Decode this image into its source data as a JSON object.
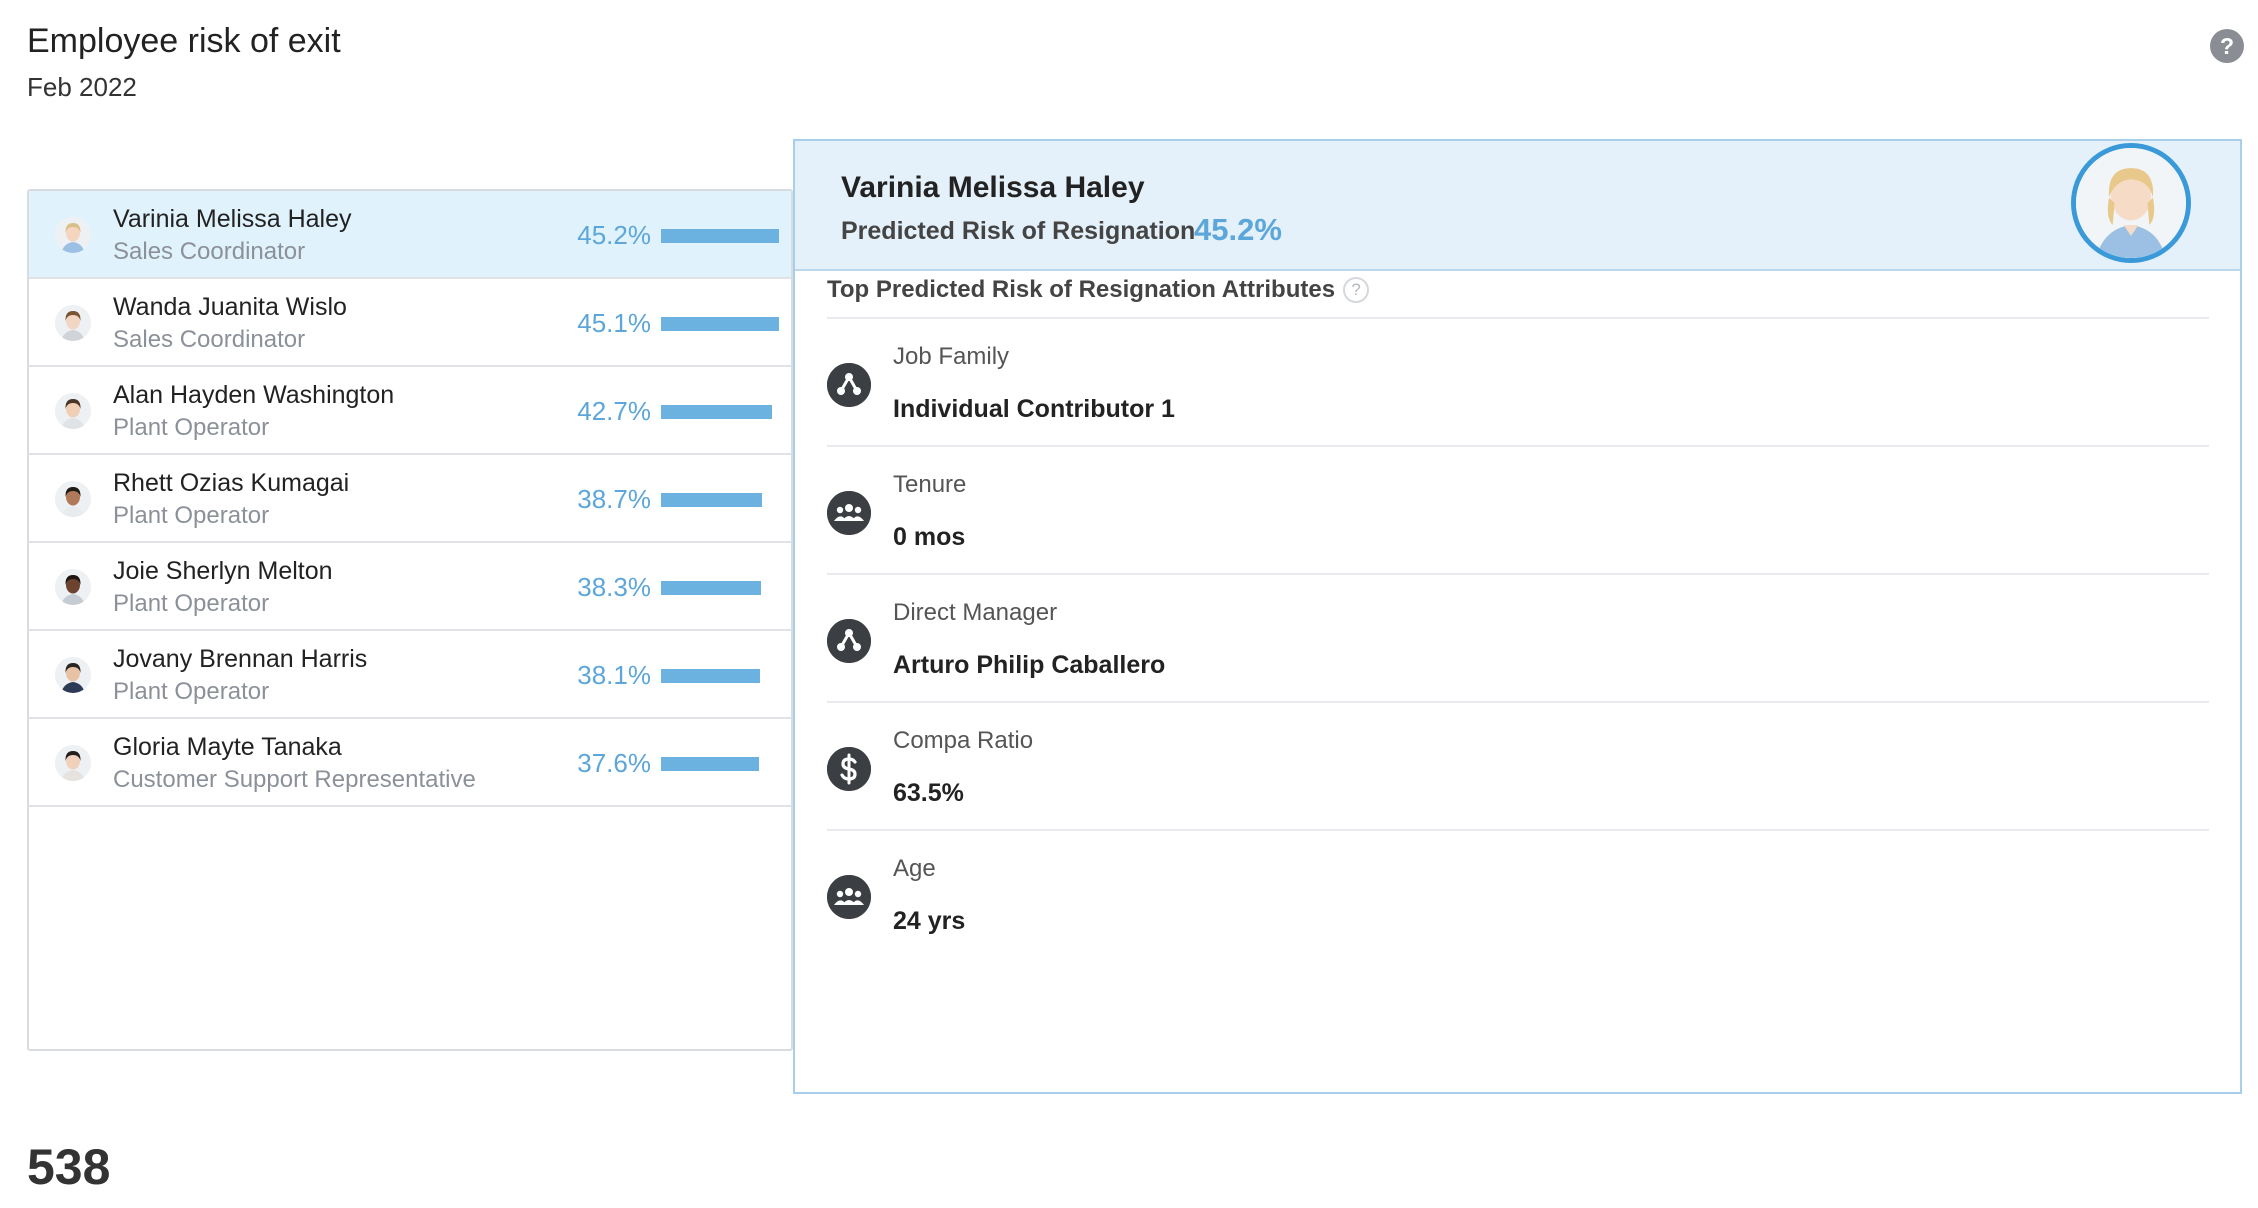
{
  "header": {
    "title": "Employee risk of exit",
    "period": "Feb 2022",
    "help_icon": "question-circle-icon",
    "help_glyph": "?"
  },
  "employees": [
    {
      "name": "Varinia Melissa Haley",
      "job": "Sales Coordinator",
      "risk": "45.2%",
      "risk_value": 45.2,
      "selected": true
    },
    {
      "name": "Wanda Juanita Wislo",
      "job": "Sales Coordinator",
      "risk": "45.1%",
      "risk_value": 45.1,
      "selected": false
    },
    {
      "name": "Alan Hayden Washington",
      "job": "Plant Operator",
      "risk": "42.7%",
      "risk_value": 42.7,
      "selected": false
    },
    {
      "name": "Rhett Ozias Kumagai",
      "job": "Plant Operator",
      "risk": "38.7%",
      "risk_value": 38.7,
      "selected": false
    },
    {
      "name": "Joie Sherlyn Melton",
      "job": "Plant Operator",
      "risk": "38.3%",
      "risk_value": 38.3,
      "selected": false
    },
    {
      "name": "Jovany Brennan Harris",
      "job": "Plant Operator",
      "risk": "38.1%",
      "risk_value": 38.1,
      "selected": false
    },
    {
      "name": "Gloria Mayte Tanaka",
      "job": "Customer Support Representative",
      "risk": "37.6%",
      "risk_value": 37.6,
      "selected": false
    }
  ],
  "detail": {
    "name": "Varinia Melissa Haley",
    "risk_label": "Predicted Risk of Resignation",
    "risk_value": "45.2%",
    "attributes_heading": "Top Predicted Risk of Resignation Attributes",
    "attributes_help_glyph": "?",
    "attributes": [
      {
        "label": "Job Family",
        "value": "Individual Contributor 1",
        "icon": "org-chart-icon"
      },
      {
        "label": "Tenure",
        "value": "0 mos",
        "icon": "group-icon"
      },
      {
        "label": "Direct Manager",
        "value": "Arturo Philip Caballero",
        "icon": "org-chart-icon"
      },
      {
        "label": "Compa Ratio",
        "value": "63.5%",
        "icon": "dollar-icon"
      },
      {
        "label": "Age",
        "value": "24 yrs",
        "icon": "group-icon"
      }
    ]
  },
  "footer": {
    "total": "538"
  },
  "colors": {
    "accent": "#5ca6d9",
    "bar": "#6bb2e1",
    "selected_row": "#e0f2fc",
    "detail_header": "#e4f1fa",
    "photo_ring": "#3a9ad9"
  }
}
